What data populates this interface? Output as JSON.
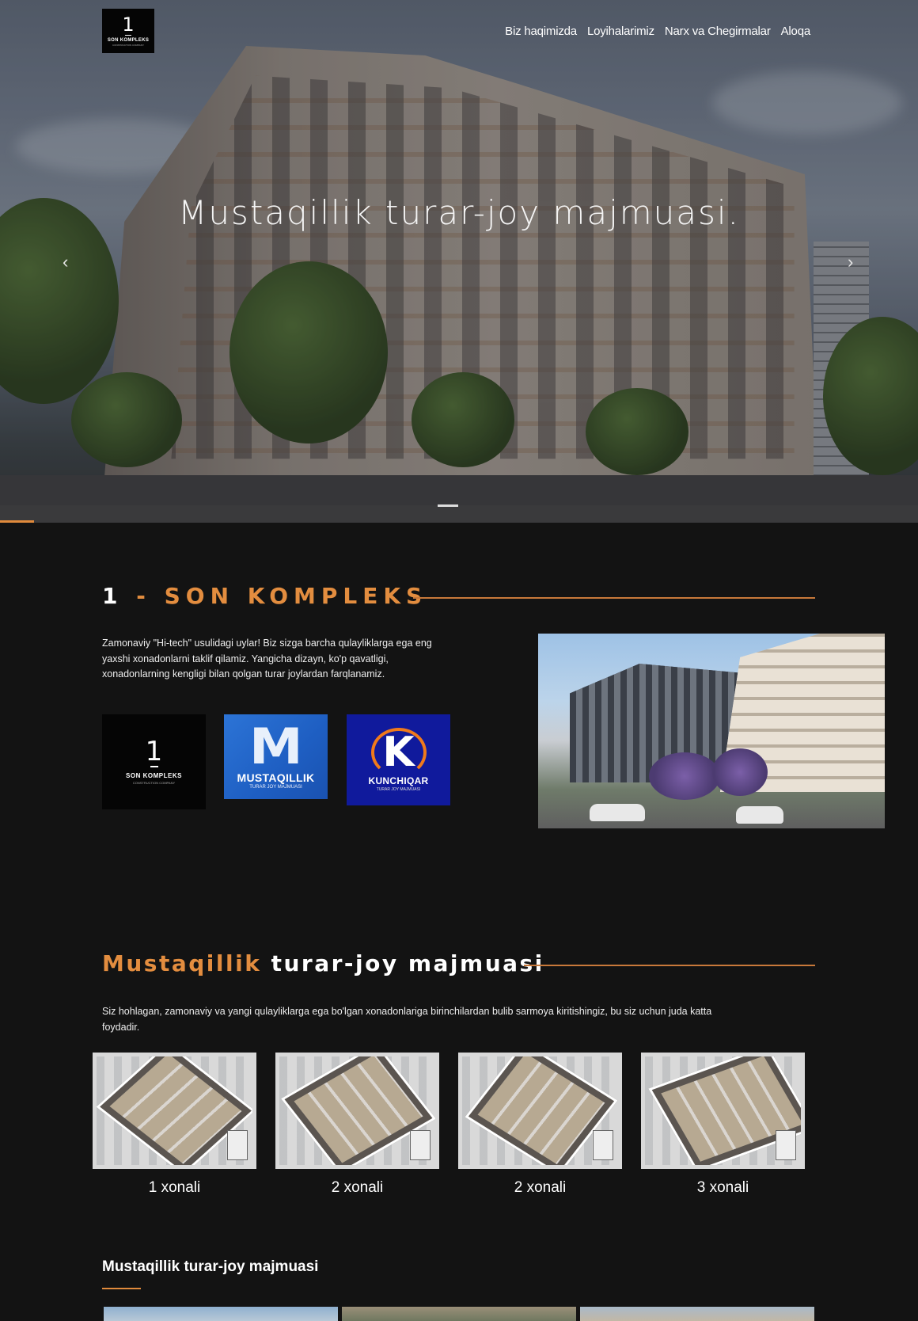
{
  "header": {
    "logo": {
      "number": "1",
      "name": "SON KOMPLEKS",
      "tagline": "CONSTRUCTION COMPANY"
    },
    "nav": [
      "Biz haqimizda",
      "Loyihalarimiz",
      "Narx va Chegirmalar",
      "Aloqa"
    ]
  },
  "hero": {
    "title": "Mustaqillik turar-joy majmuasi.",
    "prev_icon": "chevron-left-icon",
    "next_icon": "chevron-right-icon"
  },
  "about": {
    "title_number": "1",
    "title_dash": " - ",
    "title_word": "SON KOMPLEKS",
    "text": "Zamonaviy \"Hi-tech\" usulidagi uylar! Biz sizga barcha qulayliklarga ega eng yaxshi xonadonlarni taklif qilamiz. Yangicha dizayn, ko'p qavatligi, xonadonlarning kengligi bilan qolgan turar joylardan farqlanamiz.",
    "brands": [
      {
        "number": "1",
        "name": "SON KOMPLEKS",
        "tagline": "CONSTRUCTION COMPANY"
      },
      {
        "mark": "M",
        "name": "MUSTAQILLIK",
        "tagline": "TURAR JOY MAJMUASI"
      },
      {
        "mark": "K",
        "name": "KUNCHIQAR",
        "tagline": "TURAR JOY MAJMUASI"
      }
    ]
  },
  "complex": {
    "title_first": "M",
    "title_rest": "ustaqillik",
    "title_tail": "turar-joy majmuasi",
    "text": "Siz hohlagan, zamonaviy va yangi qulayliklarga ega bo'lgan xonadonlariga birinchilardan bulib sarmoya kiritishingiz, bu siz uchun juda katta foydadir.",
    "plans": [
      "1 xonali",
      "2 xonali",
      "2 xonali",
      "3 xonali"
    ]
  },
  "gallery": {
    "title": "Mustaqillik turar-joy majmuasi"
  },
  "colors": {
    "accent": "#e38d3f",
    "background": "#131313"
  }
}
